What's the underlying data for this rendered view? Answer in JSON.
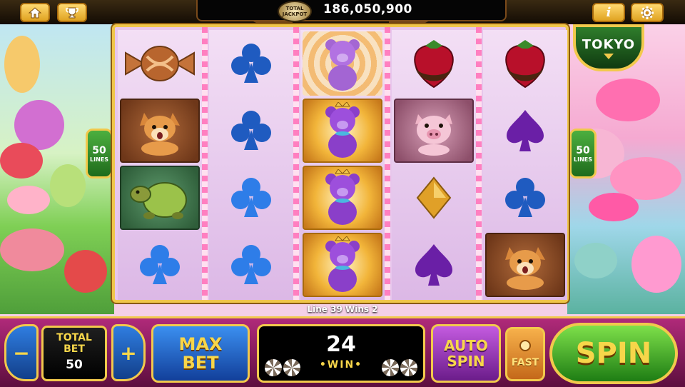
{
  "colors": {
    "frame_gold": "#f2c94c",
    "bottom_bar": "#b02a7a",
    "spin_green": "#4caf3f",
    "button_blue": "#2f7de0",
    "button_purple": "#9a2fc0",
    "text_yellow": "#f7d64a"
  },
  "top_bar": {
    "home_icon": "home-icon",
    "trophy_icon": "trophy-icon",
    "info_icon": "info-icon",
    "settings_icon": "gear-icon",
    "jackpot_badge_line1": "TOTAL",
    "jackpot_badge_line2": "JACKPOT",
    "jackpot_value": "186,050,900"
  },
  "tokyo_badge": {
    "label": "TOKYO"
  },
  "lines_left": {
    "count": "50",
    "label": "LINES"
  },
  "lines_right": {
    "count": "50",
    "label": "LINES"
  },
  "reels": [
    [
      "candy",
      "dog",
      "turtle",
      "club"
    ],
    [
      "club",
      "club",
      "club",
      "club"
    ],
    [
      "purple-bear",
      "purple-bear-gold",
      "purple-bear-gold",
      "purple-bear-gold"
    ],
    [
      "strawberry",
      "pig",
      "diamond",
      "spade"
    ],
    [
      "strawberry",
      "spade",
      "club",
      "dog"
    ]
  ],
  "status": {
    "text": "Line 39 Wins 2"
  },
  "bottom_bar": {
    "decrease_label": "−",
    "total_bet_label_1": "TOTAL",
    "total_bet_label_2": "BET",
    "total_bet_value": "50",
    "increase_label": "+",
    "max_bet_1": "MAX",
    "max_bet_2": "BET",
    "win_value": "24",
    "win_label": "•WIN•",
    "auto_spin_1": "AUTO",
    "auto_spin_2": "SPIN",
    "fast_label": "FAST",
    "spin_label": "SPIN"
  }
}
